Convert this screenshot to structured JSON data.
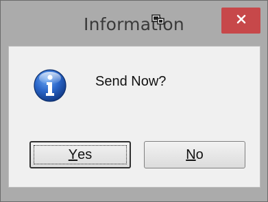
{
  "window": {
    "title": "Information"
  },
  "titlebar": {
    "close_label": "×"
  },
  "dialog": {
    "message": "Send Now?",
    "icon": "information-icon"
  },
  "buttons": {
    "yes": {
      "mnemonic": "Y",
      "rest": "es"
    },
    "no": {
      "mnemonic": "N",
      "rest": "o"
    }
  },
  "colors": {
    "frame": "#ababab",
    "close_button": "#c7484a",
    "client_background": "#f0f0f0",
    "icon_blue": "#1f5fbf"
  }
}
